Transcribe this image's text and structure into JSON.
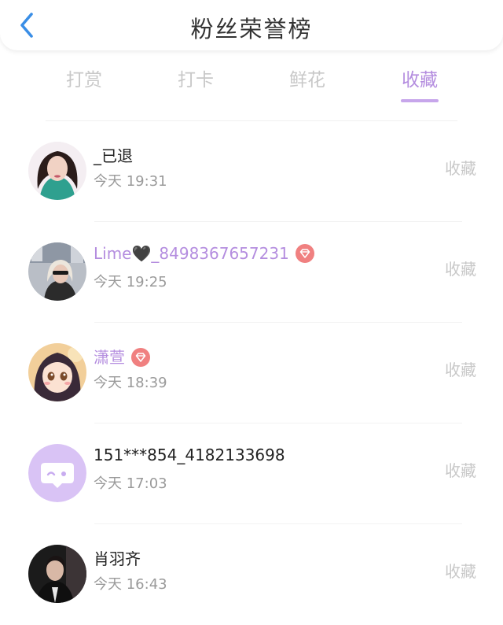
{
  "header": {
    "title": "粉丝荣誉榜",
    "back_icon": "chevron-left-icon"
  },
  "colors": {
    "accent": "#b48ddf",
    "underline": "#c7a6eb",
    "badge": "#f08080",
    "inactive": "#c8c8c8"
  },
  "tabs": [
    {
      "label": "打赏",
      "active": false
    },
    {
      "label": "打卡",
      "active": false
    },
    {
      "label": "鲜花",
      "active": false
    },
    {
      "label": "收藏",
      "active": true
    }
  ],
  "fans": [
    {
      "name": "_已退",
      "time": "今天 19:31",
      "action": "收藏",
      "vip": false,
      "avatar": "photo"
    },
    {
      "name": "Lime🖤_8498367657231",
      "time": "今天 19:25",
      "action": "收藏",
      "vip": true,
      "avatar": "photo"
    },
    {
      "name": "潇萱",
      "time": "今天 18:39",
      "action": "收藏",
      "vip": true,
      "avatar": "anime"
    },
    {
      "name": "151***854_4182133698",
      "time": "今天 17:03",
      "action": "收藏",
      "vip": false,
      "avatar": "default-chat-icon"
    },
    {
      "name": "肖羽齐",
      "time": "今天 16:43",
      "action": "收藏",
      "vip": false,
      "avatar": "photo"
    }
  ]
}
